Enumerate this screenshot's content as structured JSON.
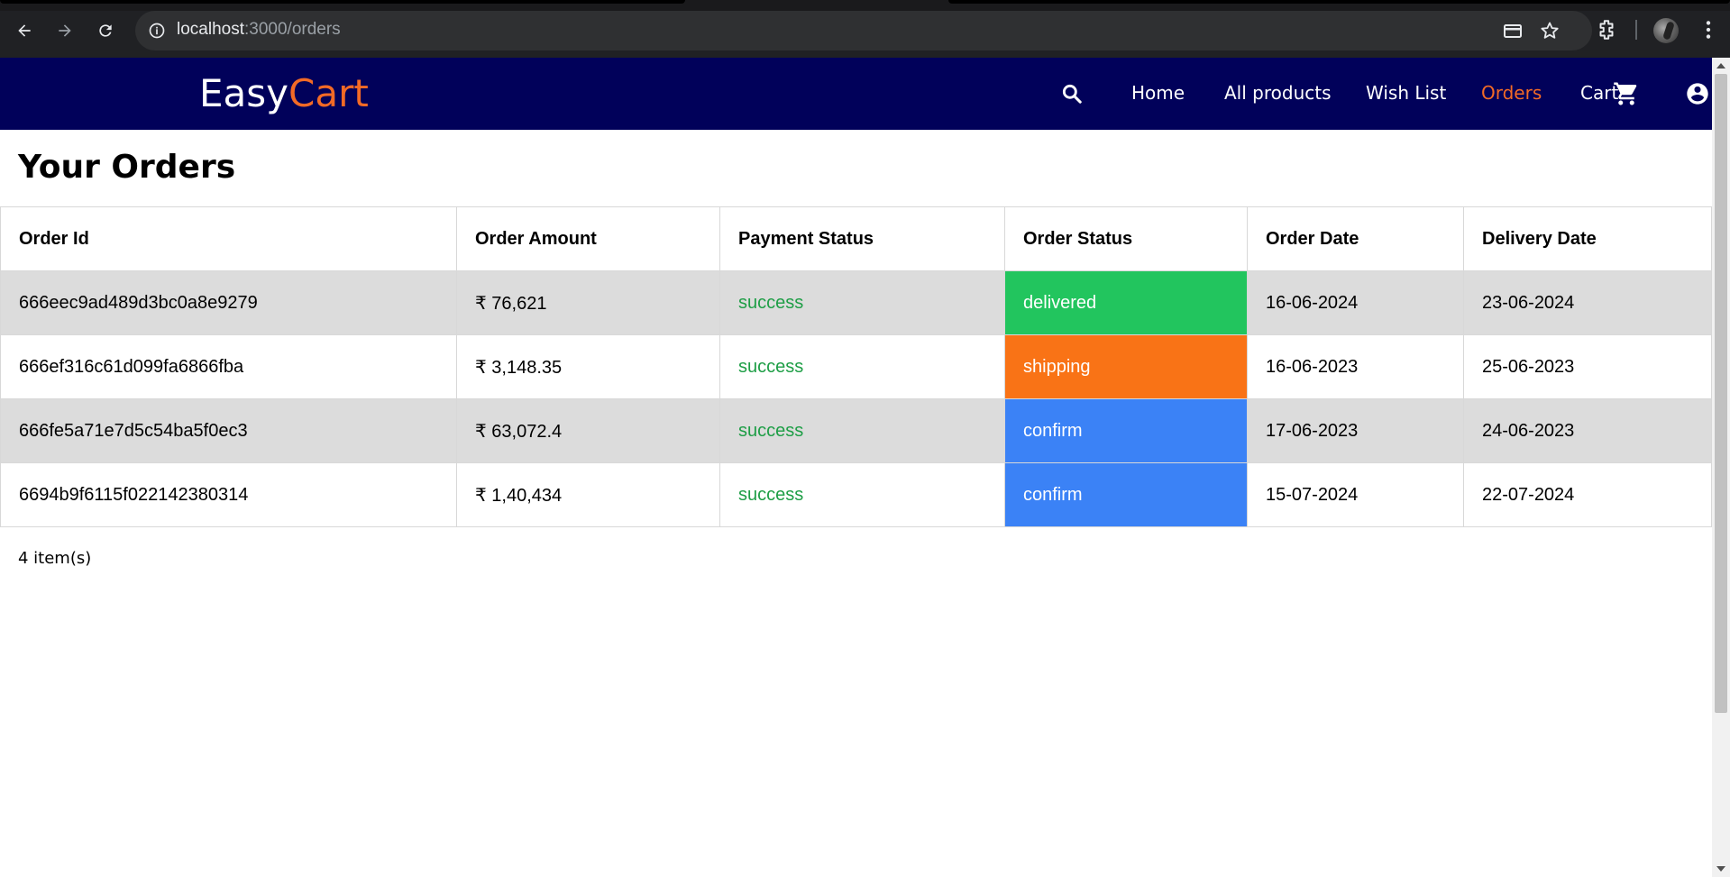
{
  "browser": {
    "url_host": "localhost",
    "url_path": ":3000/orders",
    "icons": [
      "back-arrow-icon",
      "forward-arrow-icon",
      "reload-icon",
      "site-info-icon",
      "card-icon",
      "star-icon",
      "extensions-icon",
      "profile-avatar",
      "more-vert-icon"
    ]
  },
  "header": {
    "logo_part1": "Easy",
    "logo_part2": "Cart",
    "nav": {
      "home": "Home",
      "all_products": "All products",
      "wish_list": "Wish List",
      "orders": "Orders",
      "cart": "Cart"
    },
    "active_item": "Orders",
    "accent_color": "#f26a26",
    "background_color": "#01015a"
  },
  "main": {
    "title": "Your Orders",
    "table": {
      "headers": [
        "Order Id",
        "Order Amount",
        "Payment Status",
        "Order Status",
        "Order Date",
        "Delivery Date"
      ],
      "rows": [
        {
          "order_id": "666eec9ad489d3bc0a8e9279",
          "amount": "₹ 76,621",
          "payment_status": "success",
          "order_status": "delivered",
          "status_color": "#22c55e",
          "order_date": "16-06-2024",
          "delivery_date": "23-06-2024"
        },
        {
          "order_id": "666ef316c61d099fa6866fba",
          "amount": "₹ 3,148.35",
          "payment_status": "success",
          "order_status": "shipping",
          "status_color": "#f97316",
          "order_date": "16-06-2023",
          "delivery_date": "25-06-2023"
        },
        {
          "order_id": "666fe5a71e7d5c54ba5f0ec3",
          "amount": "₹ 63,072.4",
          "payment_status": "success",
          "order_status": "confirm",
          "status_color": "#3b82f6",
          "order_date": "17-06-2023",
          "delivery_date": "24-06-2023"
        },
        {
          "order_id": "6694b9f6115f022142380314",
          "amount": "₹ 1,40,434",
          "payment_status": "success",
          "order_status": "confirm",
          "status_color": "#3b82f6",
          "order_date": "15-07-2024",
          "delivery_date": "22-07-2024"
        }
      ]
    },
    "items_count": "4 item(s)"
  }
}
